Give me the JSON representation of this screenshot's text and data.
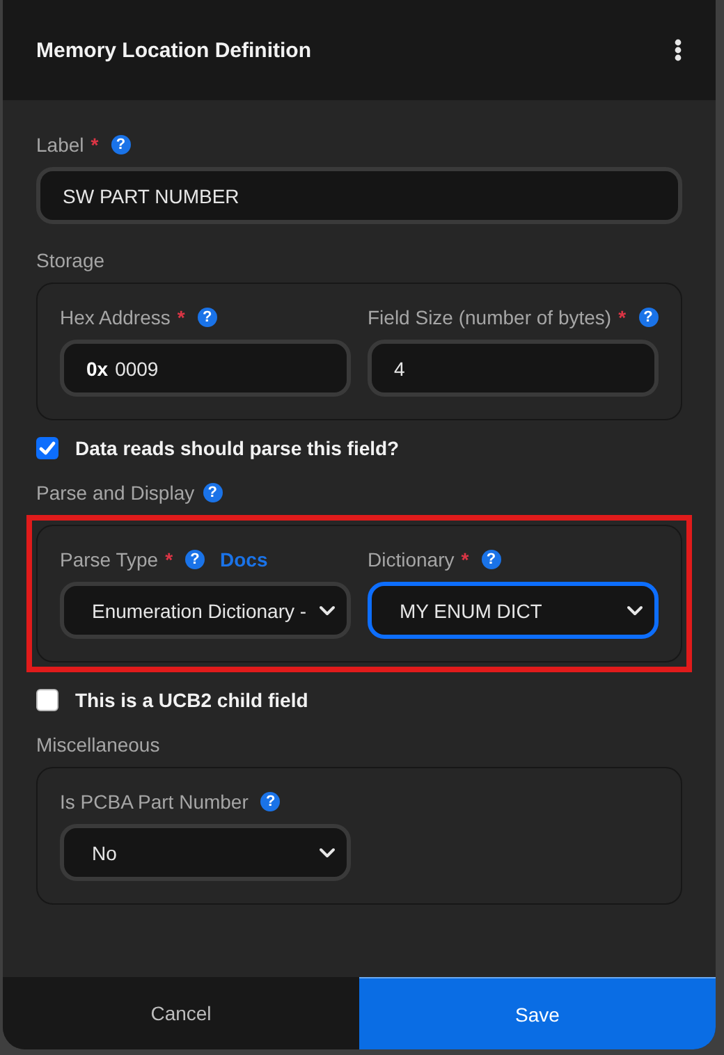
{
  "dialog": {
    "title": "Memory Location Definition"
  },
  "sections": [
    {
      "kind": "field",
      "field": {
        "label": "Label",
        "required_mark": "*",
        "help": "?",
        "value": "SW PART NUMBER"
      }
    },
    {
      "kind": "group",
      "title": "Storage",
      "highlighted": false,
      "fields": [
        {
          "label": "Hex Address",
          "required_mark": "*",
          "help": "?",
          "kind": "text",
          "prefix": "0x",
          "value": "0009"
        },
        {
          "label": "Field Size (number of bytes)",
          "required_mark": "*",
          "help": "?",
          "kind": "text",
          "value": "4"
        }
      ]
    },
    {
      "kind": "checkbox",
      "label": "Data reads should parse this field?",
      "checked": true
    },
    {
      "kind": "group",
      "title": "Parse and Display",
      "help": "?",
      "highlighted": true,
      "fields": [
        {
          "label": "Parse Type",
          "required_mark": "*",
          "help": "?",
          "link": "Docs",
          "kind": "select",
          "value": "Enumeration Dictionary - ",
          "focused": false
        },
        {
          "label": "Dictionary",
          "required_mark": "*",
          "help": "?",
          "kind": "select",
          "value": "MY ENUM DICT",
          "focused": true
        }
      ]
    },
    {
      "kind": "checkbox",
      "label": "This is a UCB2 child field",
      "checked": false
    },
    {
      "kind": "group",
      "title": "Miscellaneous",
      "highlighted": false,
      "fields": [
        {
          "label": "Is PCBA Part Number",
          "help": "?",
          "kind": "select",
          "value": "No",
          "focused": false
        }
      ]
    }
  ],
  "buttons": [
    {
      "label": "Cancel",
      "kind": "secondary"
    },
    {
      "label": "Save",
      "kind": "primary"
    }
  ]
}
